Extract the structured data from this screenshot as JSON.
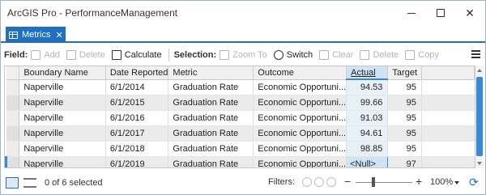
{
  "window": {
    "title": "ArcGIS Pro - PerformanceManagement"
  },
  "tab": {
    "label": "Metrics"
  },
  "toolbar": {
    "field_label": "Field:",
    "add": "Add",
    "delete": "Delete",
    "calculate": "Calculate",
    "selection_label": "Selection:",
    "zoom_to": "Zoom To",
    "switch": "Switch",
    "clear": "Clear",
    "sel_delete": "Delete",
    "copy": "Copy"
  },
  "table": {
    "columns": [
      "Boundary Name",
      "Date Reported",
      "Metric",
      "Outcome",
      "Actual",
      "Target"
    ],
    "rows": [
      [
        "Naperville",
        "6/1/2014",
        "Graduation Rate",
        "Economic Opportuni...",
        "94.53",
        "95"
      ],
      [
        "Naperville",
        "6/1/2015",
        "Graduation Rate",
        "Economic Opportuni...",
        "99.66",
        "95"
      ],
      [
        "Naperville",
        "6/1/2016",
        "Graduation Rate",
        "Economic Opportuni...",
        "91.03",
        "95"
      ],
      [
        "Naperville",
        "6/1/2017",
        "Graduation Rate",
        "Economic Opportuni...",
        "94.61",
        "95"
      ],
      [
        "Naperville",
        "6/1/2018",
        "Graduation Rate",
        "Economic Opportuni...",
        "98.85",
        "95"
      ],
      [
        "Naperville",
        "6/1/2019",
        "Graduation Rate",
        "Economic Opportuni...",
        "<Null>",
        "97"
      ]
    ]
  },
  "status": {
    "selected": "0 of 6 selected",
    "filters_label": "Filters:",
    "zoom": "100%",
    "zoom_level": 0.3
  },
  "colors": {
    "accent": "#1f6fc5",
    "selected_header": "#cfe3f5"
  }
}
